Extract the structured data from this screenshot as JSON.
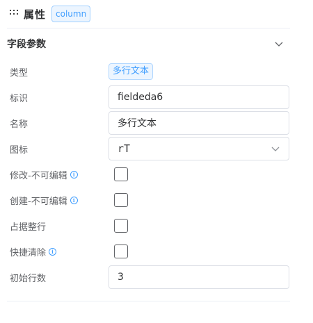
{
  "header": {
    "title": "属性",
    "tag": "column"
  },
  "section": {
    "title": "字段参数"
  },
  "fields": {
    "type": {
      "label": "类型",
      "value": "多行文本"
    },
    "identifier": {
      "label": "标识",
      "value": "fieldeda6"
    },
    "name": {
      "label": "名称",
      "value": "多行文本"
    },
    "icon": {
      "label": "图标",
      "value": "rT",
      "icon_name": "multiline-text-icon"
    },
    "edit_readonly": {
      "label": "修改-不可编辑",
      "checked": false,
      "info": "i"
    },
    "create_readonly": {
      "label": "创建-不可编辑",
      "checked": false,
      "info": "i"
    },
    "full_row": {
      "label": "占据整行",
      "checked": false
    },
    "quick_clear": {
      "label": "快捷清除",
      "checked": false,
      "info": "i"
    },
    "initial_rows": {
      "label": "初始行数",
      "value": "3"
    }
  },
  "colors": {
    "accent": "#409eff",
    "tag_bg": "#ecf5ff",
    "border": "#dcdfe6"
  }
}
